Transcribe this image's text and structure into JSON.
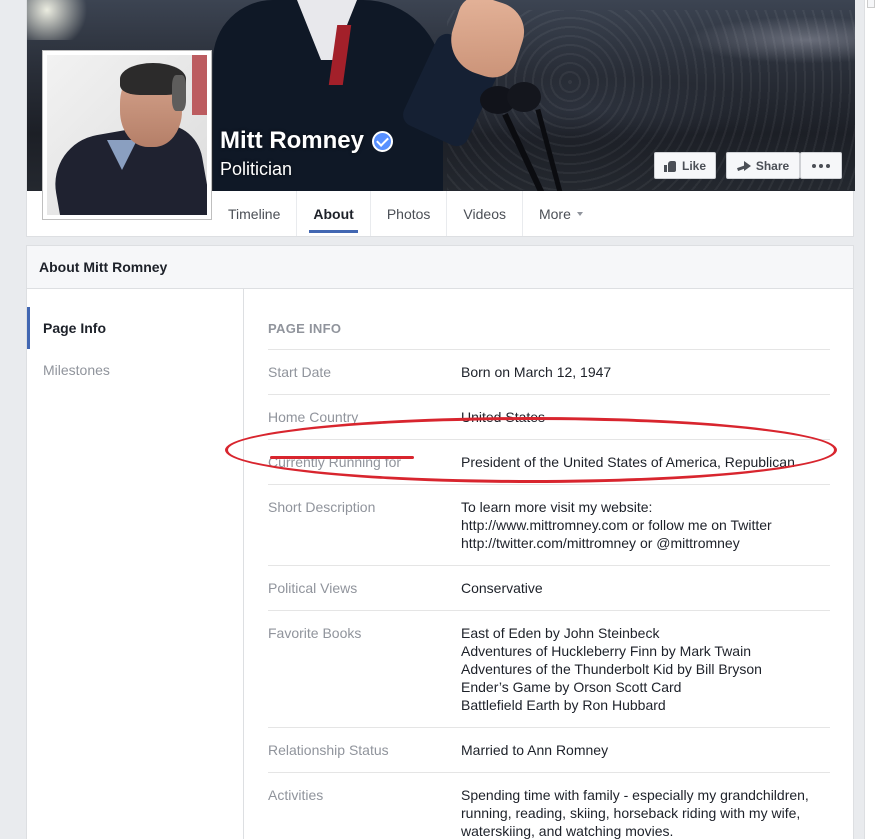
{
  "page": {
    "name": "Mitt Romney",
    "category": "Politician"
  },
  "actions": {
    "like": "Like",
    "share": "Share"
  },
  "tabs": [
    {
      "label": "Timeline"
    },
    {
      "label": "About"
    },
    {
      "label": "Photos"
    },
    {
      "label": "Videos"
    },
    {
      "label": "More"
    }
  ],
  "about": {
    "header": "About Mitt Romney",
    "nav": [
      "Page Info",
      "Milestones"
    ],
    "section_title": "PAGE INFO",
    "rows": [
      {
        "label": "Start Date",
        "lines": [
          "Born on March 12, 1947"
        ]
      },
      {
        "label": "Home Country",
        "lines": [
          "United States"
        ]
      },
      {
        "label": "Currently Running for",
        "lines": [
          "President of the United States of America, Republican"
        ]
      },
      {
        "label": "Short Description",
        "lines": [
          "To learn more visit my website:",
          "http://www.mittromney.com or follow me on Twitter",
          "http://twitter.com/mittromney or @mittromney"
        ]
      },
      {
        "label": "Political Views",
        "lines": [
          "Conservative"
        ]
      },
      {
        "label": "Favorite Books",
        "lines": [
          "East of Eden by John Steinbeck",
          "Adventures of Huckleberry Finn by Mark Twain",
          "Adventures of the Thunderbolt Kid by Bill Bryson",
          "Ender’s Game by Orson Scott Card",
          "Battlefield Earth by Ron Hubbard"
        ]
      },
      {
        "label": "Relationship Status",
        "lines": [
          "Married to Ann Romney"
        ]
      },
      {
        "label": "Activities",
        "lines": [
          "Spending time with family - especially my grandchildren,",
          "running, reading, skiing, horseback riding with my wife,",
          "waterskiing, and watching movies."
        ]
      }
    ]
  },
  "colors": {
    "accent": "#4267b2",
    "annotation": "#d8252e",
    "verified": "#5890ff"
  }
}
